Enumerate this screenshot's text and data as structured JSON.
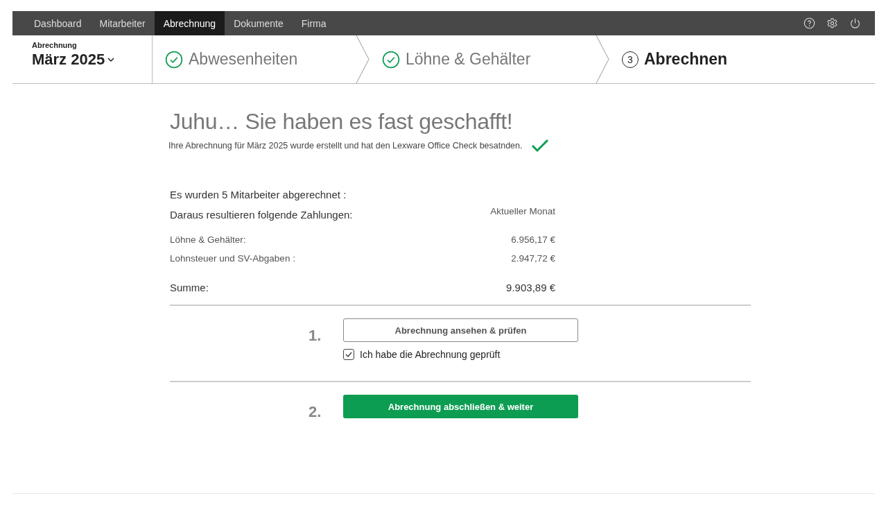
{
  "nav": {
    "items": [
      {
        "label": "Dashboard",
        "selected": false
      },
      {
        "label": "Mitarbeiter",
        "selected": false
      },
      {
        "label": "Abrechnung",
        "selected": true
      },
      {
        "label": "Dokumente",
        "selected": false
      },
      {
        "label": "Firma",
        "selected": false
      }
    ]
  },
  "period": {
    "label": "Abrechnung",
    "value": "März 2025"
  },
  "steps": [
    {
      "label": "Abwesenheiten",
      "done": true,
      "selected": false
    },
    {
      "label": "Löhne & Gehälter",
      "done": true,
      "selected": false
    },
    {
      "label": "Abrechnen",
      "done": false,
      "selected": true,
      "number": "3"
    }
  ],
  "heading": "Juhu… Sie haben es fast geschafft!",
  "subtitle": "Ihre Abrechnung für März 2025 wurde erstellt und hat den Lexware Office Check besatnden.",
  "summary": {
    "employees": "Es wurden 5 Mitarbeiter abgerechnet :",
    "payments_label": "Daraus resultieren folgende Zahlungen:",
    "column": "Aktueller Monat",
    "rows": [
      {
        "label": "Löhne & Gehälter:",
        "amount": "6.956,17 €"
      },
      {
        "label": "Lohnsteuer und SV-Abgaben :",
        "amount": "2.947,72 €"
      }
    ],
    "total": {
      "label": "Summe:",
      "amount": "9.903,89 €"
    }
  },
  "actions": [
    {
      "number": "1.",
      "kind": "outline",
      "button": "Abrechnung ansehen & prüfen",
      "checkbox": {
        "label": "Ich habe die Abrechnung geprüft",
        "checked": true
      }
    },
    {
      "number": "2.",
      "kind": "primary",
      "button": "Abrechnung abschließen & weiter"
    }
  ]
}
